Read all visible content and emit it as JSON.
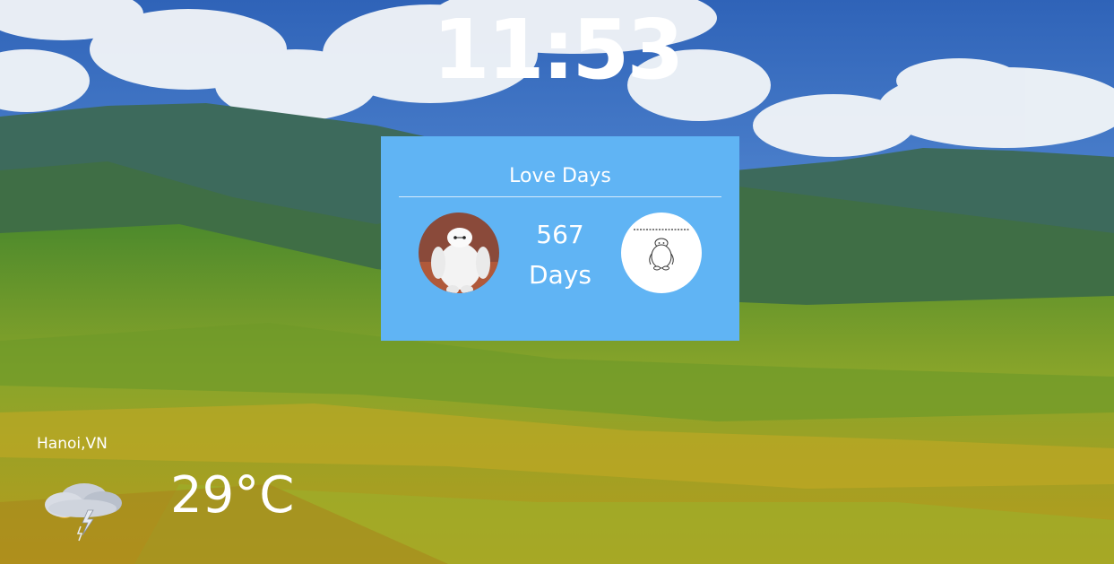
{
  "clock": {
    "time": "11:53"
  },
  "love_card": {
    "title": "Love Days",
    "count": "567",
    "unit": "Days",
    "avatar_left_icon": "baymax-photo",
    "avatar_right_icon": "baymax-sketch",
    "accent_color": "#60b4f4"
  },
  "weather": {
    "location": "Hanoi,VN",
    "temperature": "29°C",
    "icon": "thunderstorm-icon"
  }
}
